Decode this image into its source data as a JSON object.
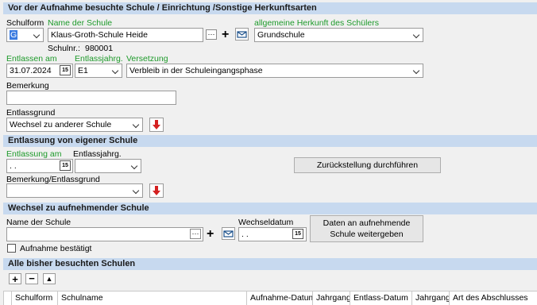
{
  "sections": {
    "previous_school": "Vor der Aufnahme besuchte Schule / Einrichtung /Sonstige Herkunftsarten",
    "own_school": "Entlassung von eigener Schule",
    "next_school": "Wechsel zu aufnehmender Schule",
    "all_schools": "Alle bisher besuchten Schulen"
  },
  "previous": {
    "schulform_label": "Schulform",
    "schulform_value": "G",
    "name_label": "Name der Schule",
    "name_value": "Klaus-Groth-Schule Heide",
    "ellipsis": "···",
    "plus": "+",
    "herkunft_label": "allgemeine Herkunft des Schülers",
    "herkunft_value": "Grundschule",
    "schulnr_label": "Schulnr.:",
    "schulnr_value": "980001",
    "entlassen_label": "Entlassen am",
    "entlassen_value": "31.07.2024",
    "entlassjahrg_label": "Entlassjahrg.",
    "entlassjahrg_value": "E1",
    "versetzung_label": "Versetzung",
    "versetzung_value": "Verbleib in der Schuleingangsphase",
    "bemerkung_label": "Bemerkung",
    "bemerkung_value": "",
    "entlassgrund_label": "Entlassgrund",
    "entlassgrund_value": "Wechsel zu anderer Schule",
    "calendar_glyph": "15"
  },
  "own": {
    "entlassung_label": "Entlassung am",
    "entlassung_value": " .  .",
    "entlassjahrg_label": "Entlassjahrg.",
    "entlassjahrg_value": "",
    "zurueck_button": "Zurückstellung durchführen",
    "bemerkung_label": "Bemerkung/Entlassgrund",
    "bemerkung_value": ""
  },
  "next": {
    "name_label": "Name der Schule",
    "name_value": "",
    "wechseldatum_label": "Wechseldatum",
    "wechseldatum_value": " .  .",
    "daten_button_line1": "Daten an aufnehmende",
    "daten_button_line2": "Schule weitergeben",
    "aufnahme_label": "Aufnahme bestätigt"
  },
  "all": {
    "add": "+",
    "remove": "−",
    "up": "▲",
    "columns": [
      "Schulform",
      "Schulname",
      "Aufnahme-Datum",
      "Jahrgang",
      "Entlass-Datum",
      "Jahrgang",
      "Art des Abschlusses"
    ]
  },
  "colors": {
    "header_bg": "#c7d9ef",
    "label_green": "#1d9a2a",
    "arrow_red": "#d42020"
  }
}
